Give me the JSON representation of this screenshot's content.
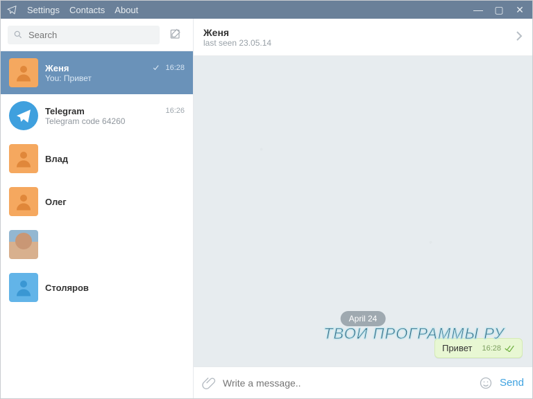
{
  "menu": {
    "settings": "Settings",
    "contacts": "Contacts",
    "about": "About"
  },
  "search": {
    "placeholder": "Search"
  },
  "chats": [
    {
      "name": "Женя",
      "preview": "You: Привет",
      "time": "16:28",
      "selected": true,
      "check": true,
      "avatar": "orange"
    },
    {
      "name": "Telegram",
      "preview": "Telegram code 64260",
      "time": "16:26",
      "selected": false,
      "avatar": "telegram"
    },
    {
      "name": "Влад",
      "preview": "",
      "time": "",
      "selected": false,
      "avatar": "orange"
    },
    {
      "name": "Олег",
      "preview": "",
      "time": "",
      "selected": false,
      "avatar": "orange"
    },
    {
      "name": "",
      "preview": "",
      "time": "",
      "selected": false,
      "avatar": "photo",
      "hide_name": true
    },
    {
      "name": "Столяров",
      "preview": "",
      "time": "",
      "selected": false,
      "avatar": "teal"
    }
  ],
  "header": {
    "name": "Женя",
    "status": "last seen 23.05.14"
  },
  "messages": {
    "date": "April 24",
    "out_text": "Привет",
    "out_time": "16:28"
  },
  "composer": {
    "placeholder": "Write a message..",
    "send": "Send"
  },
  "watermark": "ТВОИ ПРОГРАММЫ РУ"
}
